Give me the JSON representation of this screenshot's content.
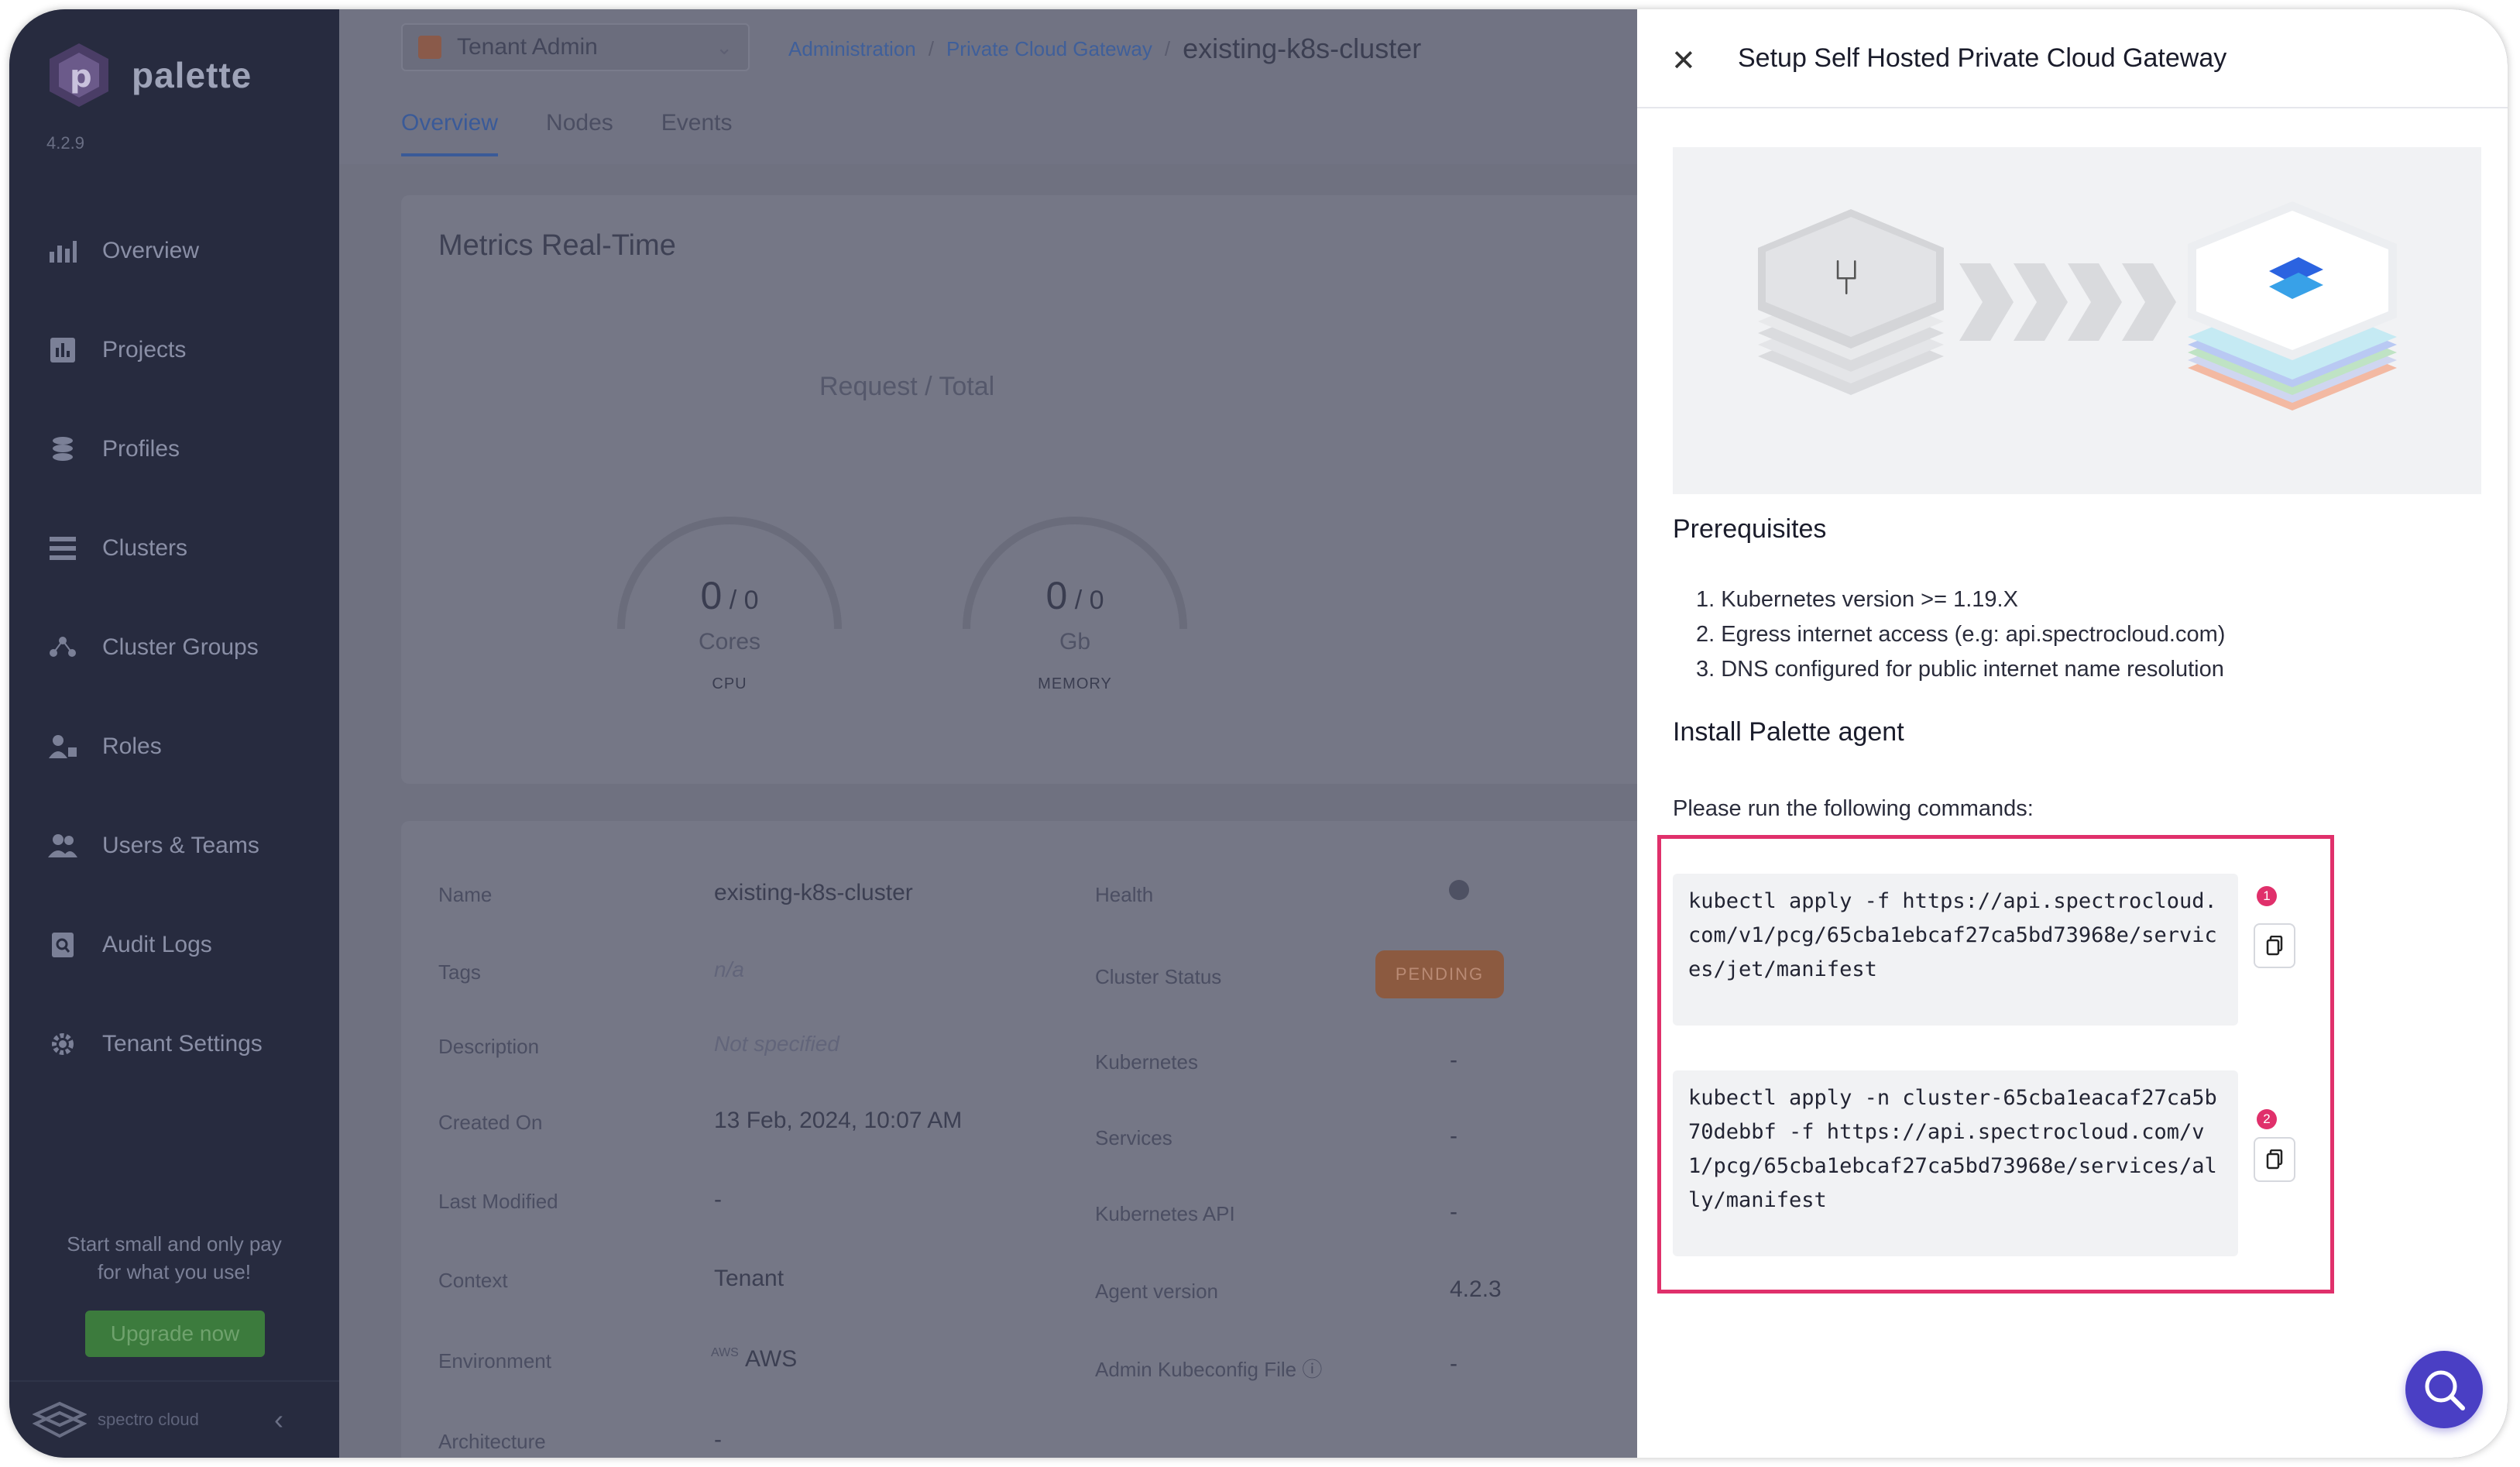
{
  "sidebar": {
    "logo_text": "palette",
    "version": "4.2.9",
    "items": [
      {
        "label": "Overview"
      },
      {
        "label": "Projects"
      },
      {
        "label": "Profiles"
      },
      {
        "label": "Clusters"
      },
      {
        "label": "Cluster Groups"
      },
      {
        "label": "Roles"
      },
      {
        "label": "Users & Teams"
      },
      {
        "label": "Audit Logs"
      },
      {
        "label": "Tenant Settings"
      }
    ],
    "promo_line1": "Start small and only pay",
    "promo_line2": "for what you use!",
    "upgrade_label": "Upgrade now",
    "brand_text": "spectro cloud",
    "collapse_icon": "chevron-left-icon"
  },
  "header": {
    "tenant_label": "Tenant Admin",
    "breadcrumbs": [
      "Administration",
      "Private Cloud Gateway"
    ],
    "current": "existing-k8s-cluster",
    "tabs": [
      "Overview",
      "Nodes",
      "Events"
    ]
  },
  "metrics": {
    "title": "Metrics Real-Time",
    "subtitle": "Request / Total",
    "cpu": {
      "used": "0",
      "total": "0",
      "unit": "Cores",
      "caption": "CPU"
    },
    "memory": {
      "used": "0",
      "total": "0",
      "unit": "Gb",
      "caption": "MEMORY"
    }
  },
  "details": {
    "left": [
      {
        "label": "Name",
        "value": "existing-k8s-cluster"
      },
      {
        "label": "Tags",
        "value": "n/a"
      },
      {
        "label": "Description",
        "value": "Not specified"
      },
      {
        "label": "Created On",
        "value": "13 Feb, 2024, 10:07 AM"
      },
      {
        "label": "Last Modified",
        "value": "-"
      },
      {
        "label": "Context",
        "value": "Tenant"
      },
      {
        "label": "Environment",
        "value": "AWS",
        "badge": "AWS"
      },
      {
        "label": "Architecture",
        "value": "-"
      }
    ],
    "right": [
      {
        "label": "Health",
        "value": ""
      },
      {
        "label": "Cluster Status",
        "value": "PENDING"
      },
      {
        "label": "Kubernetes",
        "value": "-"
      },
      {
        "label": "Services",
        "value": "-"
      },
      {
        "label": "Kubernetes API",
        "value": "-"
      },
      {
        "label": "Agent version",
        "value": "4.2.3"
      },
      {
        "label": "Admin Kubeconfig File",
        "value": "-"
      }
    ]
  },
  "drawer": {
    "title": "Setup Self Hosted Private Cloud Gateway",
    "prereq_title": "Prerequisites",
    "prereqs": [
      "1. Kubernetes version >= 1.19.X",
      "2. Egress internet access (e.g: api.spectrocloud.com)",
      "3. DNS configured for public internet name resolution"
    ],
    "install_title": "Install Palette agent",
    "hint": "Please run the following commands:",
    "commands": [
      {
        "step": "1",
        "text": "kubectl apply -f https://api.spectrocloud.com/v1/pcg/65cba1ebcaf27ca5bd73968e/services/jet/manifest"
      },
      {
        "step": "2",
        "text": "kubectl apply -n cluster-65cba1eacaf27ca5b70debbf -f https://api.spectrocloud.com/v1/pcg/65cba1ebcaf27ca5bd73968e/services/ally/manifest"
      }
    ]
  },
  "colors": {
    "sidebar_bg": "#272b3f",
    "highlight": "#e0306b",
    "fab": "#4a3fc4",
    "link": "#3f5f9a"
  }
}
